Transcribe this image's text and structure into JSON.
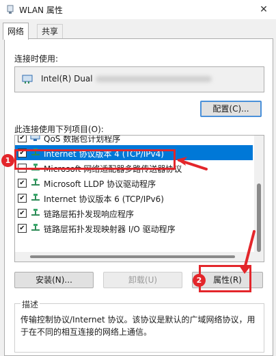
{
  "window": {
    "title": "WLAN 属性",
    "close_glyph": "✕"
  },
  "tabs": [
    {
      "label": "网络",
      "active": true
    },
    {
      "label": "共享",
      "active": false
    }
  ],
  "connection": {
    "label": "连接时使用:",
    "adapter_name": "Intel(R) Dual"
  },
  "buttons": {
    "configure": "配置(C)...",
    "install": "安装(N)...",
    "uninstall": "卸载(U)",
    "properties": "属性(R)"
  },
  "items_label": "此连接使用下列项目(O):",
  "items": [
    {
      "label": "QoS 数据包计划程序",
      "checked": true,
      "icon": "qos-scheduler-icon"
    },
    {
      "label": "Internet 协议版本 4 (TCP/IPv4)",
      "checked": true,
      "selected": true,
      "icon": "network-protocol-icon"
    },
    {
      "label": "Microsoft 网络适配器多路传送器协议",
      "checked": false,
      "icon": "network-protocol-icon"
    },
    {
      "label": "Microsoft LLDP 协议驱动程序",
      "checked": true,
      "icon": "network-protocol-icon"
    },
    {
      "label": "Internet 协议版本 6 (TCP/IPv6)",
      "checked": true,
      "icon": "network-protocol-icon"
    },
    {
      "label": "链路层拓扑发现响应程序",
      "checked": true,
      "icon": "network-protocol-icon"
    },
    {
      "label": "链路层拓扑发现映射器 I/O 驱动程序",
      "checked": true,
      "icon": "network-protocol-icon"
    }
  ],
  "description": {
    "title": "描述",
    "text": "传输控制协议/Internet 协议。该协议是默认的广域网络协议，用于在不同的相互连接的网络上通信。"
  },
  "annotations": {
    "step1": "1",
    "step2": "2",
    "color": "#e3262b"
  },
  "colors": {
    "selection": "#0078d7",
    "focus_border": "#4a90d9"
  }
}
